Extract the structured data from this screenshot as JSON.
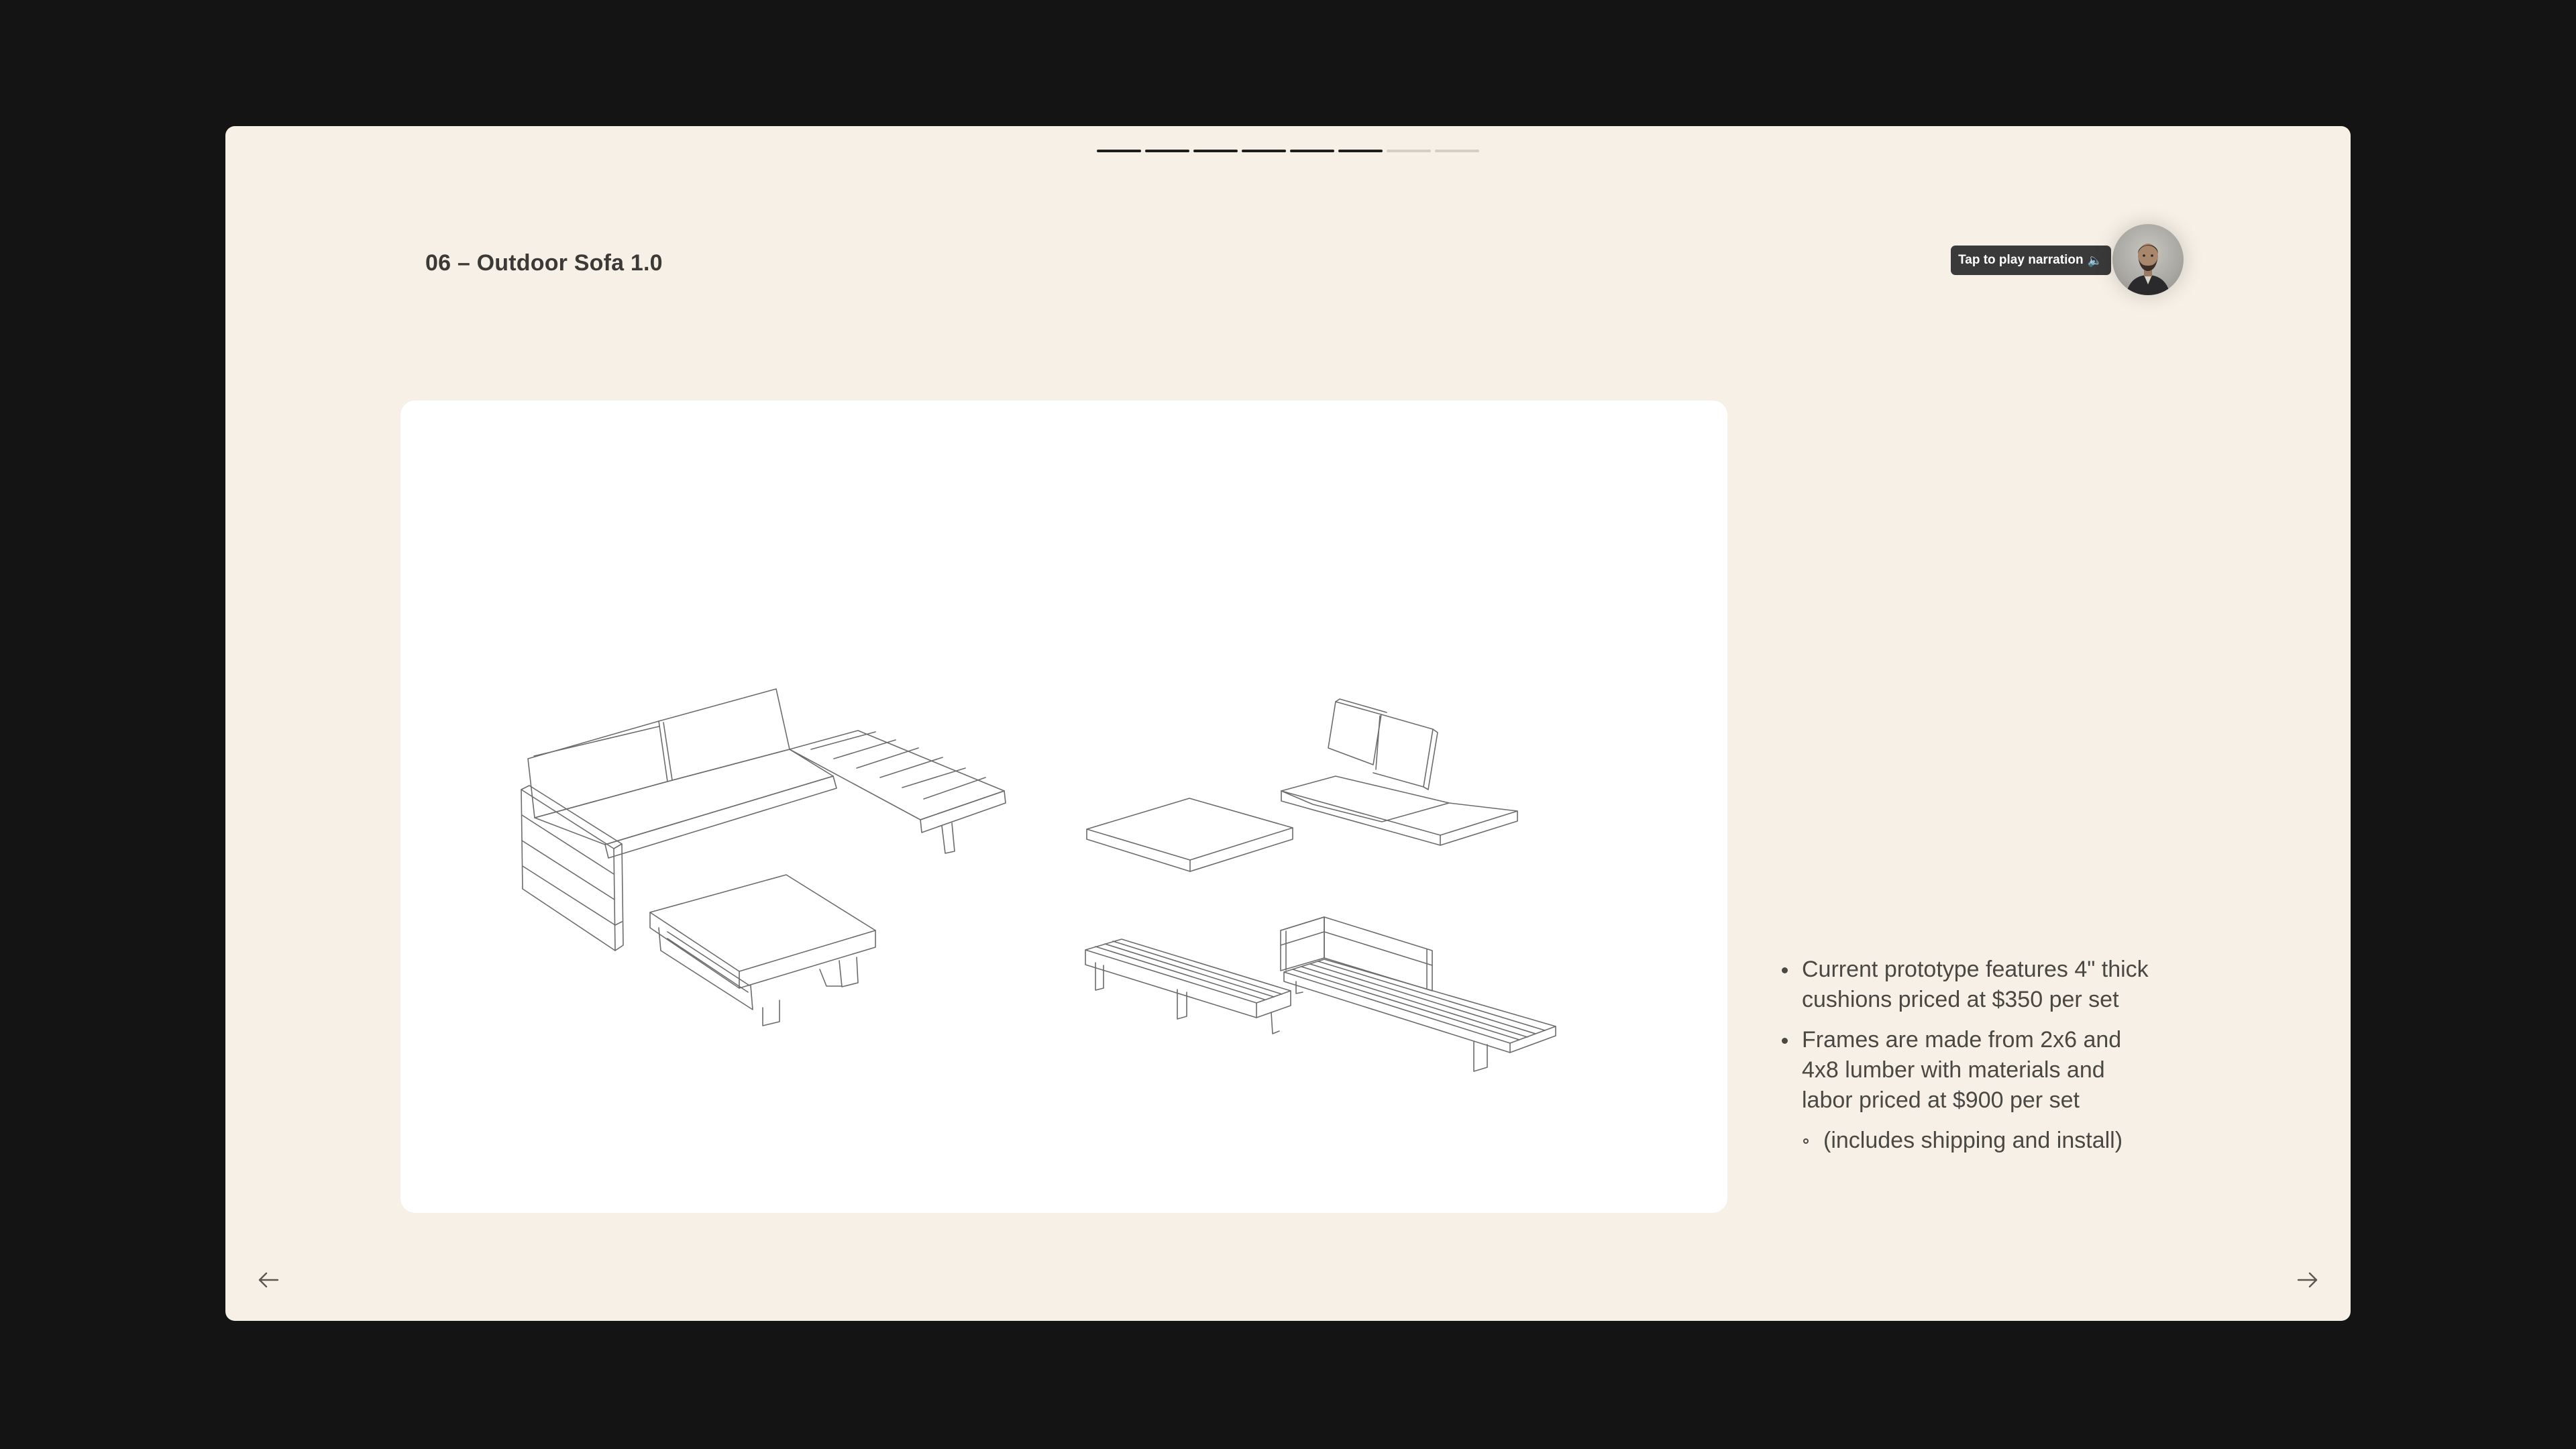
{
  "slide": {
    "title": "06 – Outdoor Sofa 1.0",
    "progress": {
      "total": 8,
      "completed": 6
    }
  },
  "narration": {
    "label": "Tap to play narration",
    "icon": "speaker-icon"
  },
  "image": {
    "description_icon": "furniture-line-drawing"
  },
  "notes": {
    "bullets": [
      "Current prototype features 4\" thick cushions priced at $350 per set",
      "Frames are made from 2x6 and 4x8 lumber with materials and labor priced at $900 per set"
    ],
    "sub_bullet": "(includes shipping and install)"
  },
  "nav": {
    "prev_icon": "arrow-left-icon",
    "next_icon": "arrow-right-icon"
  },
  "colors": {
    "page_background": "#141414",
    "slide_background": "#f7f0e6",
    "text": "#4a4843",
    "progress_done": "#1d1d1d",
    "progress_todo": "#d4cec4"
  }
}
